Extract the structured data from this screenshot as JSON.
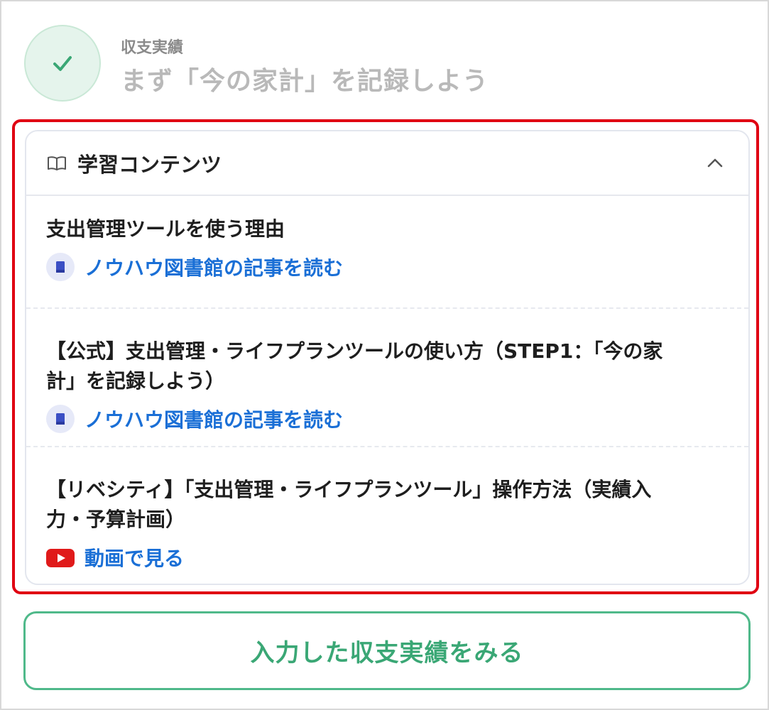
{
  "header": {
    "subtitle": "収支実績",
    "title": "まず「今の家計」を記録しよう",
    "icon": "check-icon"
  },
  "learning": {
    "heading": "学習コンテンツ",
    "items": [
      {
        "title": "支出管理ツールを使う理由",
        "link_label": "ノウハウ図書館の記事を読む",
        "link_icon": "book-icon"
      },
      {
        "title_line1": "【公式】支出管理・ライフプランツールの使い方（STEP1：「今の家",
        "title_line2": "計」を記録しよう）",
        "link_label": "ノウハウ図書館の記事を読む",
        "link_icon": "book-icon"
      },
      {
        "title_line1": "【リベシティ】「支出管理・ライフプランツール」操作方法（実績入",
        "title_line2": "力・予算計画）",
        "link_label": "動画で見る",
        "link_icon": "youtube-icon"
      }
    ]
  },
  "footer": {
    "button_label": "入力した収支実績をみる"
  },
  "colors": {
    "accent_green": "#3aa775",
    "link_blue": "#1a6fd6",
    "highlight_red": "#e00012"
  }
}
